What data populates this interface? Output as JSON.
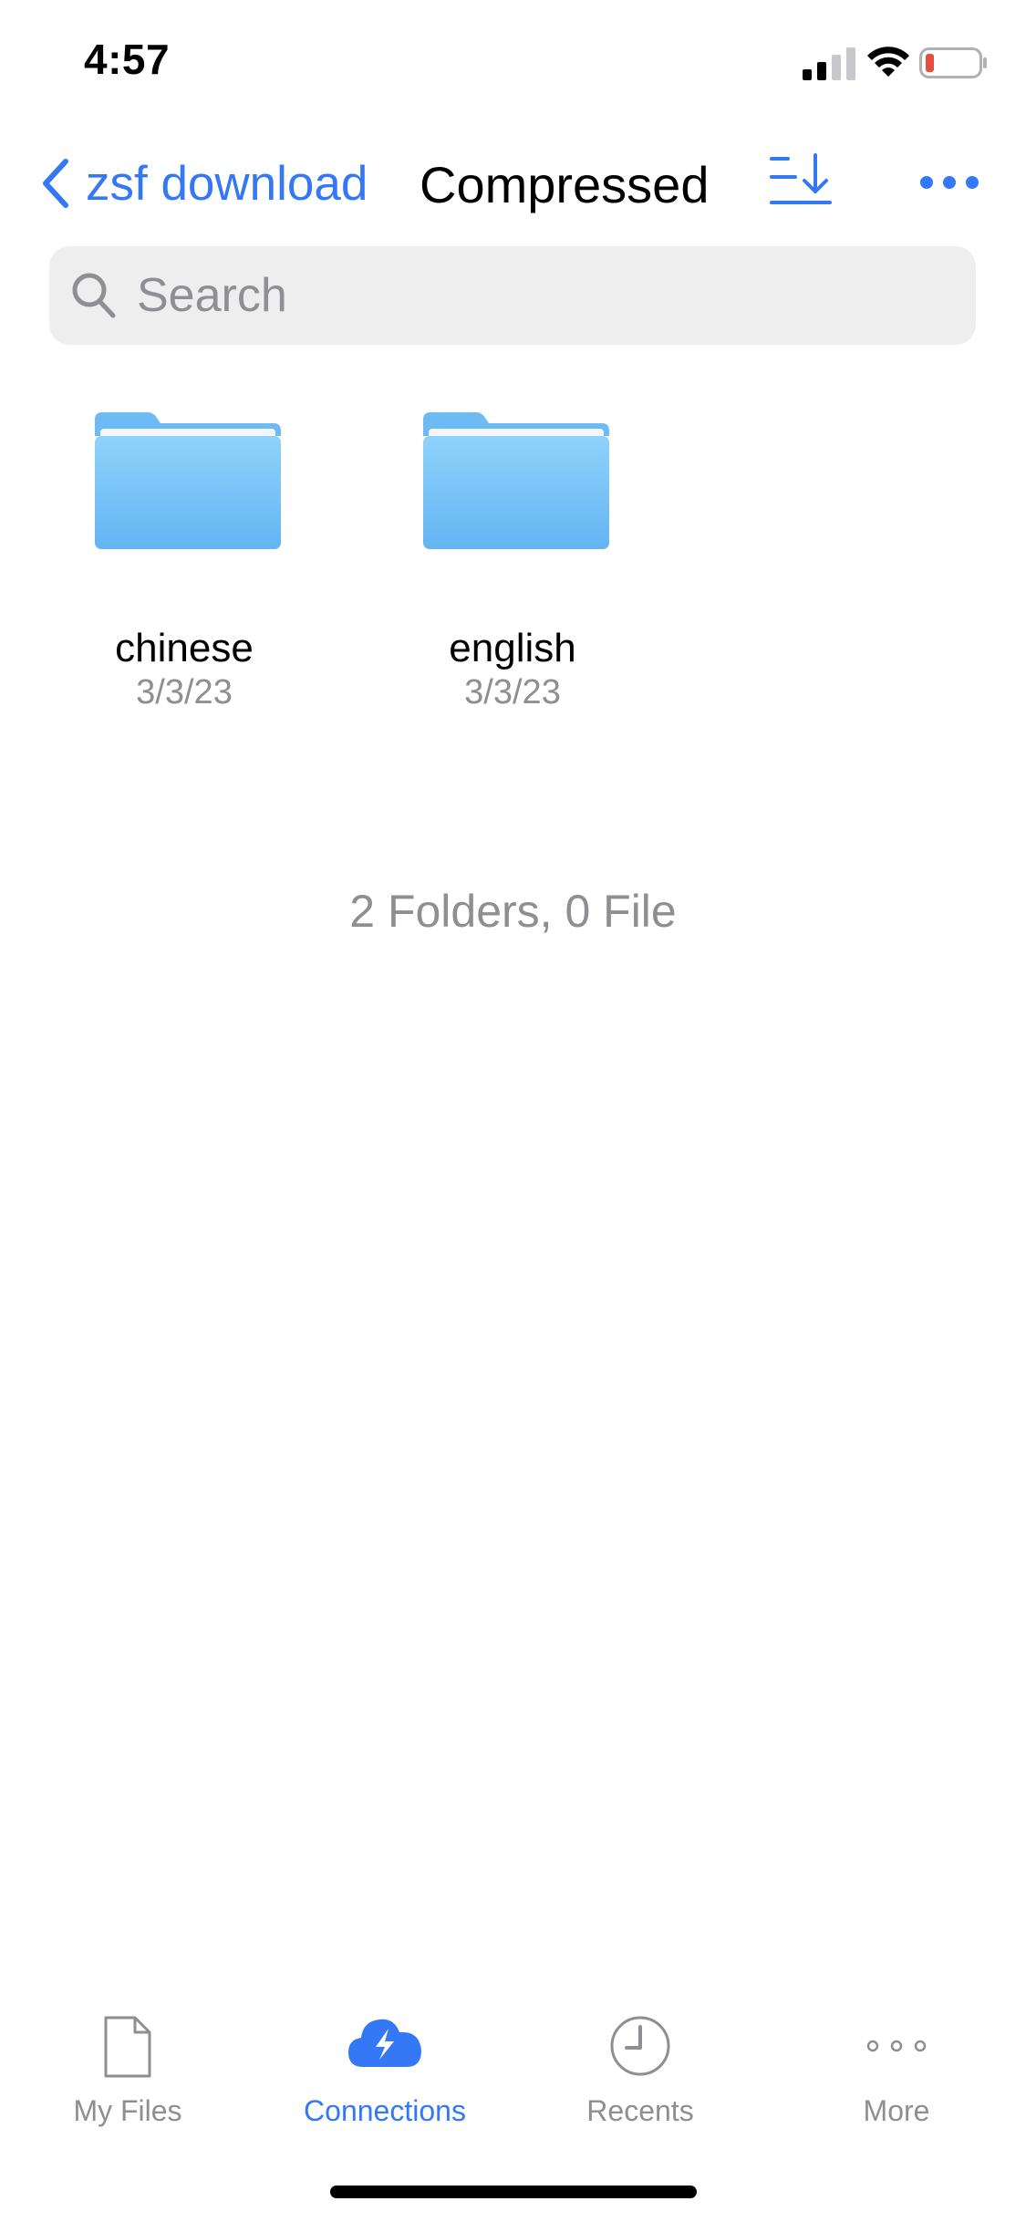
{
  "status_bar": {
    "time": "4:57",
    "signal_icon": "cellular-signal-icon",
    "wifi_icon": "wifi-icon",
    "battery_icon": "battery-low-icon",
    "battery_color": "#e74c3c"
  },
  "nav": {
    "back_label": "zsf download",
    "title": "Compressed",
    "sort_icon": "sort-download-icon",
    "more_icon": "ellipsis-icon"
  },
  "search": {
    "placeholder": "Search",
    "value": ""
  },
  "folders": [
    {
      "name": "chinese",
      "date": "3/3/23"
    },
    {
      "name": "english",
      "date": "3/3/23"
    }
  ],
  "summary": "2 Folders, 0 File",
  "tabs": [
    {
      "label": "My Files",
      "icon": "document-icon",
      "active": false
    },
    {
      "label": "Connections",
      "icon": "cloud-bolt-icon",
      "active": true
    },
    {
      "label": "Recents",
      "icon": "clock-icon",
      "active": false
    },
    {
      "label": "More",
      "icon": "ellipsis-icon",
      "active": false
    }
  ],
  "colors": {
    "accent": "#3478f6",
    "secondary_text": "#8e8e93",
    "search_background": "#eeeeef",
    "folder_light": "#8fd3fb",
    "folder_dark": "#64b4f3"
  }
}
